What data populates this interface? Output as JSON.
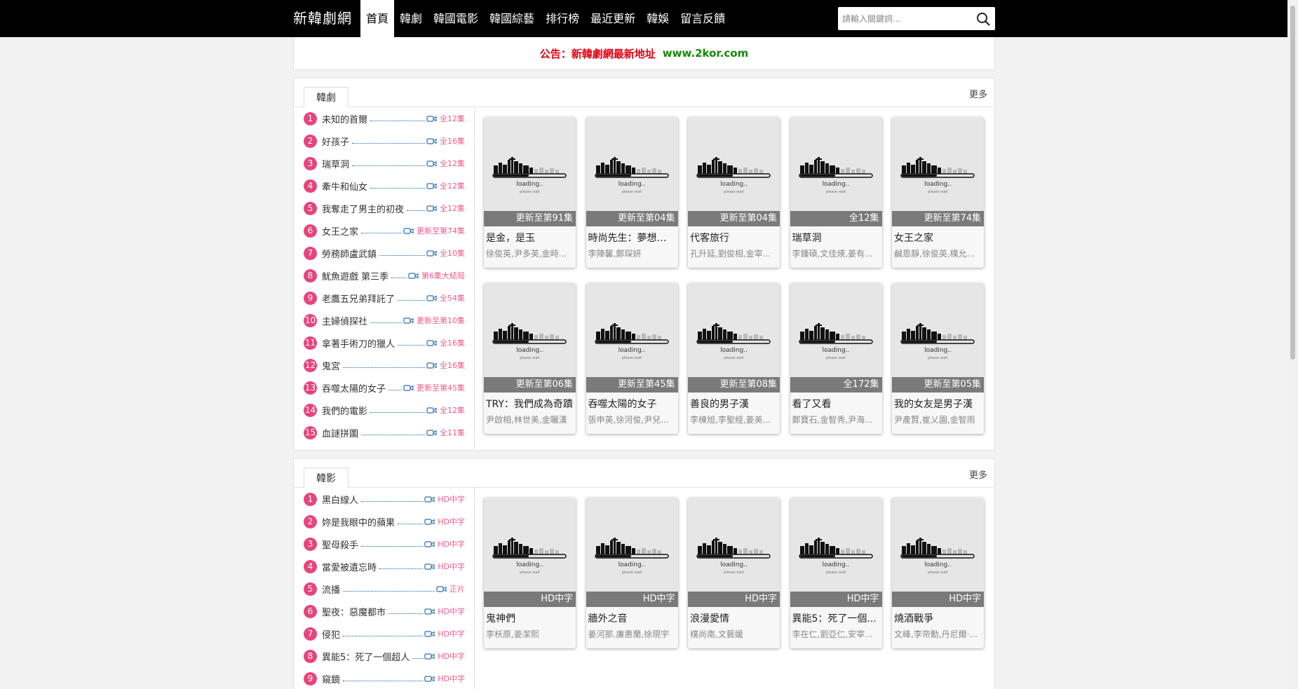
{
  "header": {
    "logo": "新韓劇網",
    "nav": [
      "首頁",
      "韓劇",
      "韓國電影",
      "韓國綜藝",
      "排行榜",
      "最近更新",
      "韓娛",
      "留言反饋"
    ],
    "search_placeholder": "請輸入關鍵詞..."
  },
  "notice": {
    "label": "公告：新韓劇網最新地址",
    "link": "www.2kor.com"
  },
  "poster_placeholder": {
    "text": "loading..",
    "subtext": "please wait"
  },
  "sections": [
    {
      "tab": "韓劇",
      "more": "更多",
      "ranks": [
        {
          "num": "1",
          "title": "未知的首爾",
          "status": "全12集"
        },
        {
          "num": "2",
          "title": "好孩子",
          "status": "全16集"
        },
        {
          "num": "3",
          "title": "瑞草洞",
          "status": "全12集"
        },
        {
          "num": "4",
          "title": "牽牛和仙女",
          "status": "全12集"
        },
        {
          "num": "5",
          "title": "我奪走了男主的初夜",
          "status": "全12集"
        },
        {
          "num": "6",
          "title": "女王之家",
          "status": "更新至第74集"
        },
        {
          "num": "7",
          "title": "勞務師盧武鎮",
          "status": "全10集"
        },
        {
          "num": "8",
          "title": "魷魚遊戲 第三季",
          "status": "第6集大結局"
        },
        {
          "num": "9",
          "title": "老鷹五兄弟拜託了",
          "status": "全54集"
        },
        {
          "num": "10",
          "title": "主婦偵探社",
          "status": "更新至第10集"
        },
        {
          "num": "11",
          "title": "拿著手術刀的獵人",
          "status": "全16集"
        },
        {
          "num": "12",
          "title": "鬼宮",
          "status": "全16集"
        },
        {
          "num": "13",
          "title": "吞噬太陽的女子",
          "status": "更新至第45集"
        },
        {
          "num": "14",
          "title": "我們的電影",
          "status": "全12集"
        },
        {
          "num": "15",
          "title": "血謎拼圖",
          "status": "全11集"
        }
      ],
      "cards": [
        {
          "badge": "更新至第91集",
          "title": "是金，是玉",
          "actors": "徐俊英,尹多英,金時..."
        },
        {
          "badge": "更新至第04集",
          "title": "時尚先生：夢想成...",
          "actors": "李陣馨,鄭琛妍"
        },
        {
          "badge": "更新至第04集",
          "title": "代客旅行",
          "actors": "孔升延,劉俊相,金宰..."
        },
        {
          "badge": "全12集",
          "title": "瑞草洞",
          "actors": "李鍾碩,文佳煐,姜有..."
        },
        {
          "badge": "更新至第74集",
          "title": "女王之家",
          "actors": "鹹恩靜,徐俊英,樸允..."
        },
        {
          "badge": "更新至第06集",
          "title": "TRY：我們成為奇蹟",
          "actors": "尹啟相,林世美,金曬漢"
        },
        {
          "badge": "更新至第45集",
          "title": "吞噬太陽的女子",
          "actors": "張申英,徐河俊,尹兒..."
        },
        {
          "badge": "更新至第08集",
          "title": "善良的男子漢",
          "actors": "李棟旭,李聖經,姜美..."
        },
        {
          "badge": "全172集",
          "title": "看了又看",
          "actors": "鄭寶石,金智秀,尹海..."
        },
        {
          "badge": "更新至第05集",
          "title": "我的女友是男子漢",
          "actors": "尹產賢,崔乂園,金智雨"
        }
      ]
    },
    {
      "tab": "韓影",
      "more": "更多",
      "ranks": [
        {
          "num": "1",
          "title": "黑白線人",
          "status": "HD中字"
        },
        {
          "num": "2",
          "title": "妳是我眼中的蘋果",
          "status": "HD中字"
        },
        {
          "num": "3",
          "title": "聖母殺手",
          "status": "HD中字"
        },
        {
          "num": "4",
          "title": "當愛被遺忘時",
          "status": "HD中字"
        },
        {
          "num": "5",
          "title": "流播",
          "status": "正片"
        },
        {
          "num": "6",
          "title": "聖夜：惡魔都市",
          "status": "HD中字"
        },
        {
          "num": "7",
          "title": "侵犯",
          "status": "HD中字"
        },
        {
          "num": "8",
          "title": "異能5：死了一個超人",
          "status": "HD中字"
        },
        {
          "num": "9",
          "title": "窺鏡",
          "status": "HD中字"
        }
      ],
      "cards": [
        {
          "badge": "HD中字",
          "title": "鬼神們",
          "actors": "李枖原,姜潔熙"
        },
        {
          "badge": "HD中字",
          "title": "牆外之音",
          "actors": "姜河那,廉惠蘭,徐現宇"
        },
        {
          "badge": "HD中字",
          "title": "浪漫愛情",
          "actors": "樸尚南,文藝媛"
        },
        {
          "badge": "HD中字",
          "title": "異能5：死了一個...",
          "actors": "李在仁,劉亞仁,安宰..."
        },
        {
          "badge": "HD中字",
          "title": "燒酒戰爭",
          "actors": "文峰,李帝勳,丹尼爾·..."
        }
      ]
    }
  ]
}
